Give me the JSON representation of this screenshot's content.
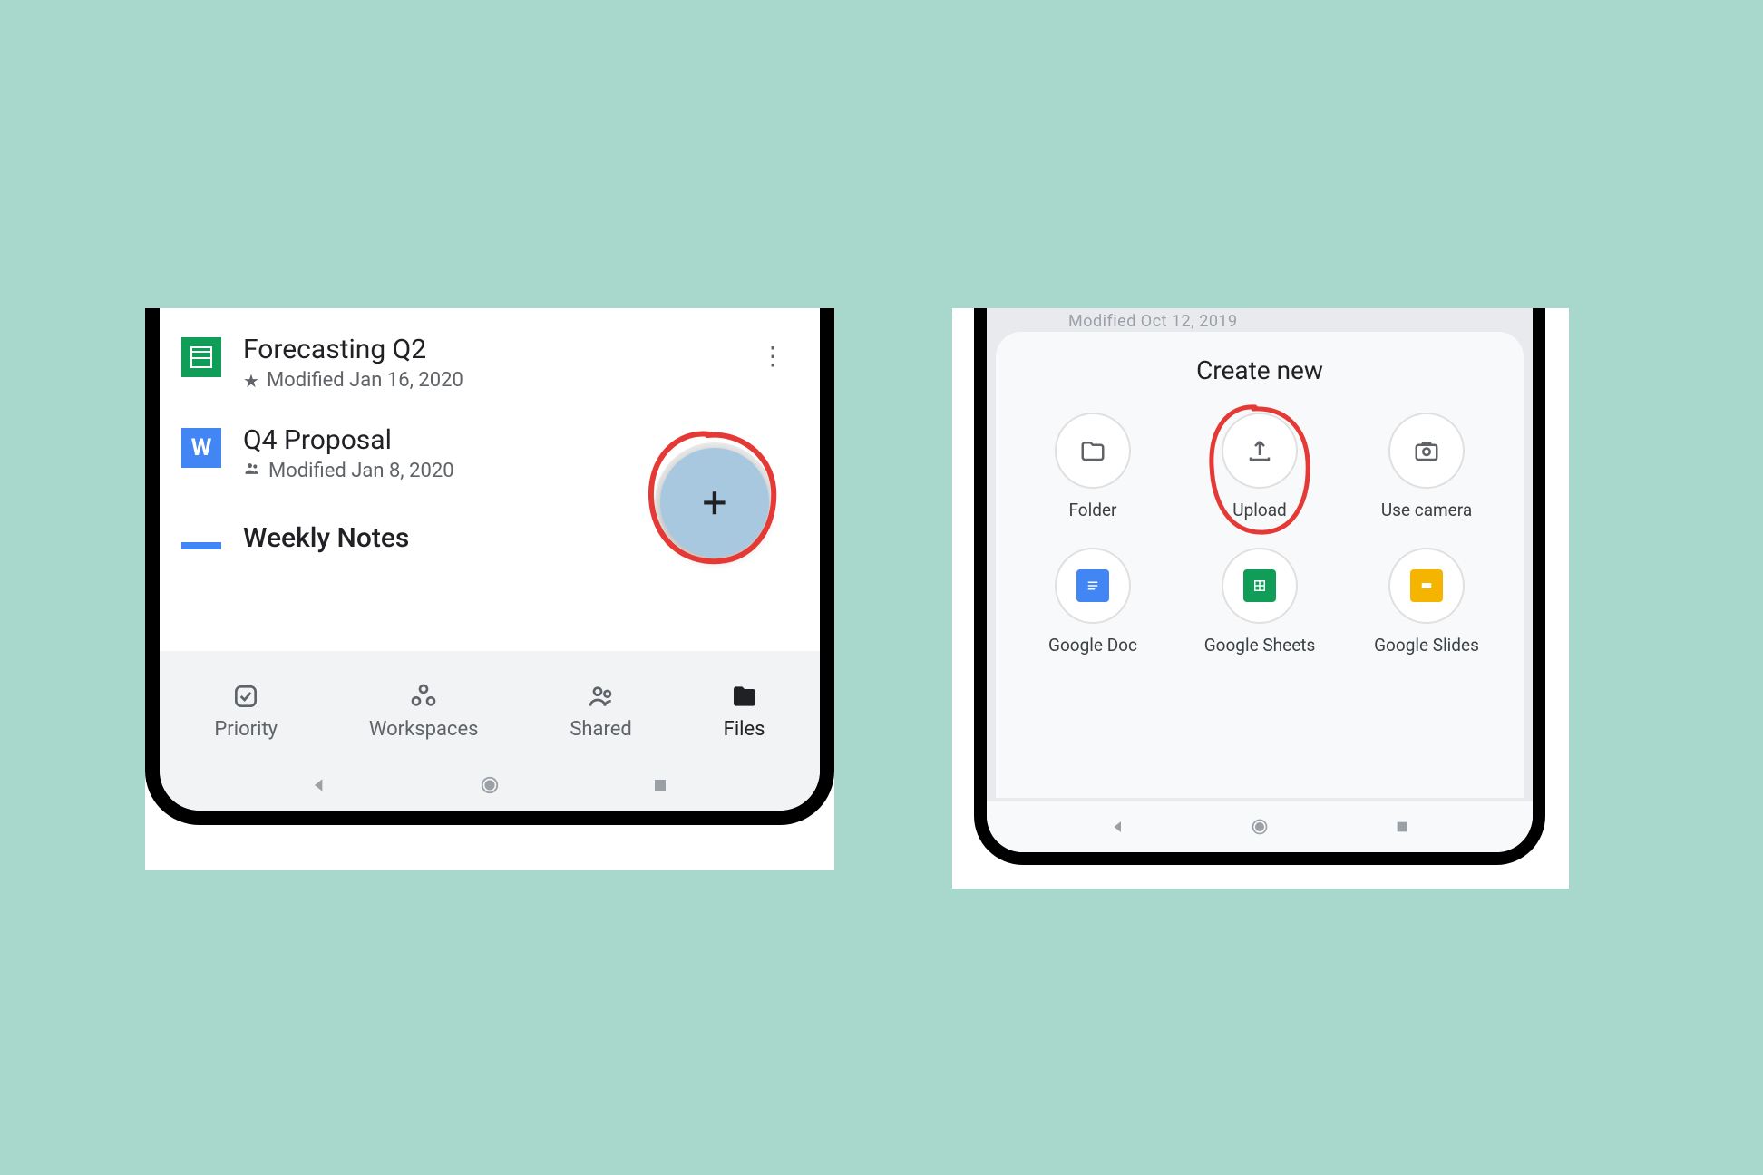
{
  "left_phone": {
    "files": [
      {
        "title": "Forecasting Q2",
        "meta": "Modified Jan 16, 2020",
        "starred": true,
        "icon": "sheets"
      },
      {
        "title": "Q4 Proposal",
        "meta": "Modified Jan 8, 2020",
        "shared": true,
        "icon": "word"
      },
      {
        "title": "Weekly Notes",
        "meta": "",
        "icon": "docs"
      }
    ],
    "fab_label": "+",
    "nav": [
      {
        "label": "Priority"
      },
      {
        "label": "Workspaces"
      },
      {
        "label": "Shared"
      },
      {
        "label": "Files"
      }
    ]
  },
  "right_phone": {
    "partial_header": "Modified Oct 12, 2019",
    "sheet_title": "Create new",
    "options": [
      {
        "label": "Folder"
      },
      {
        "label": "Upload"
      },
      {
        "label": "Use camera"
      },
      {
        "label": "Google Doc"
      },
      {
        "label": "Google Sheets"
      },
      {
        "label": "Google Slides"
      }
    ]
  },
  "annotation_color": "#e53935"
}
